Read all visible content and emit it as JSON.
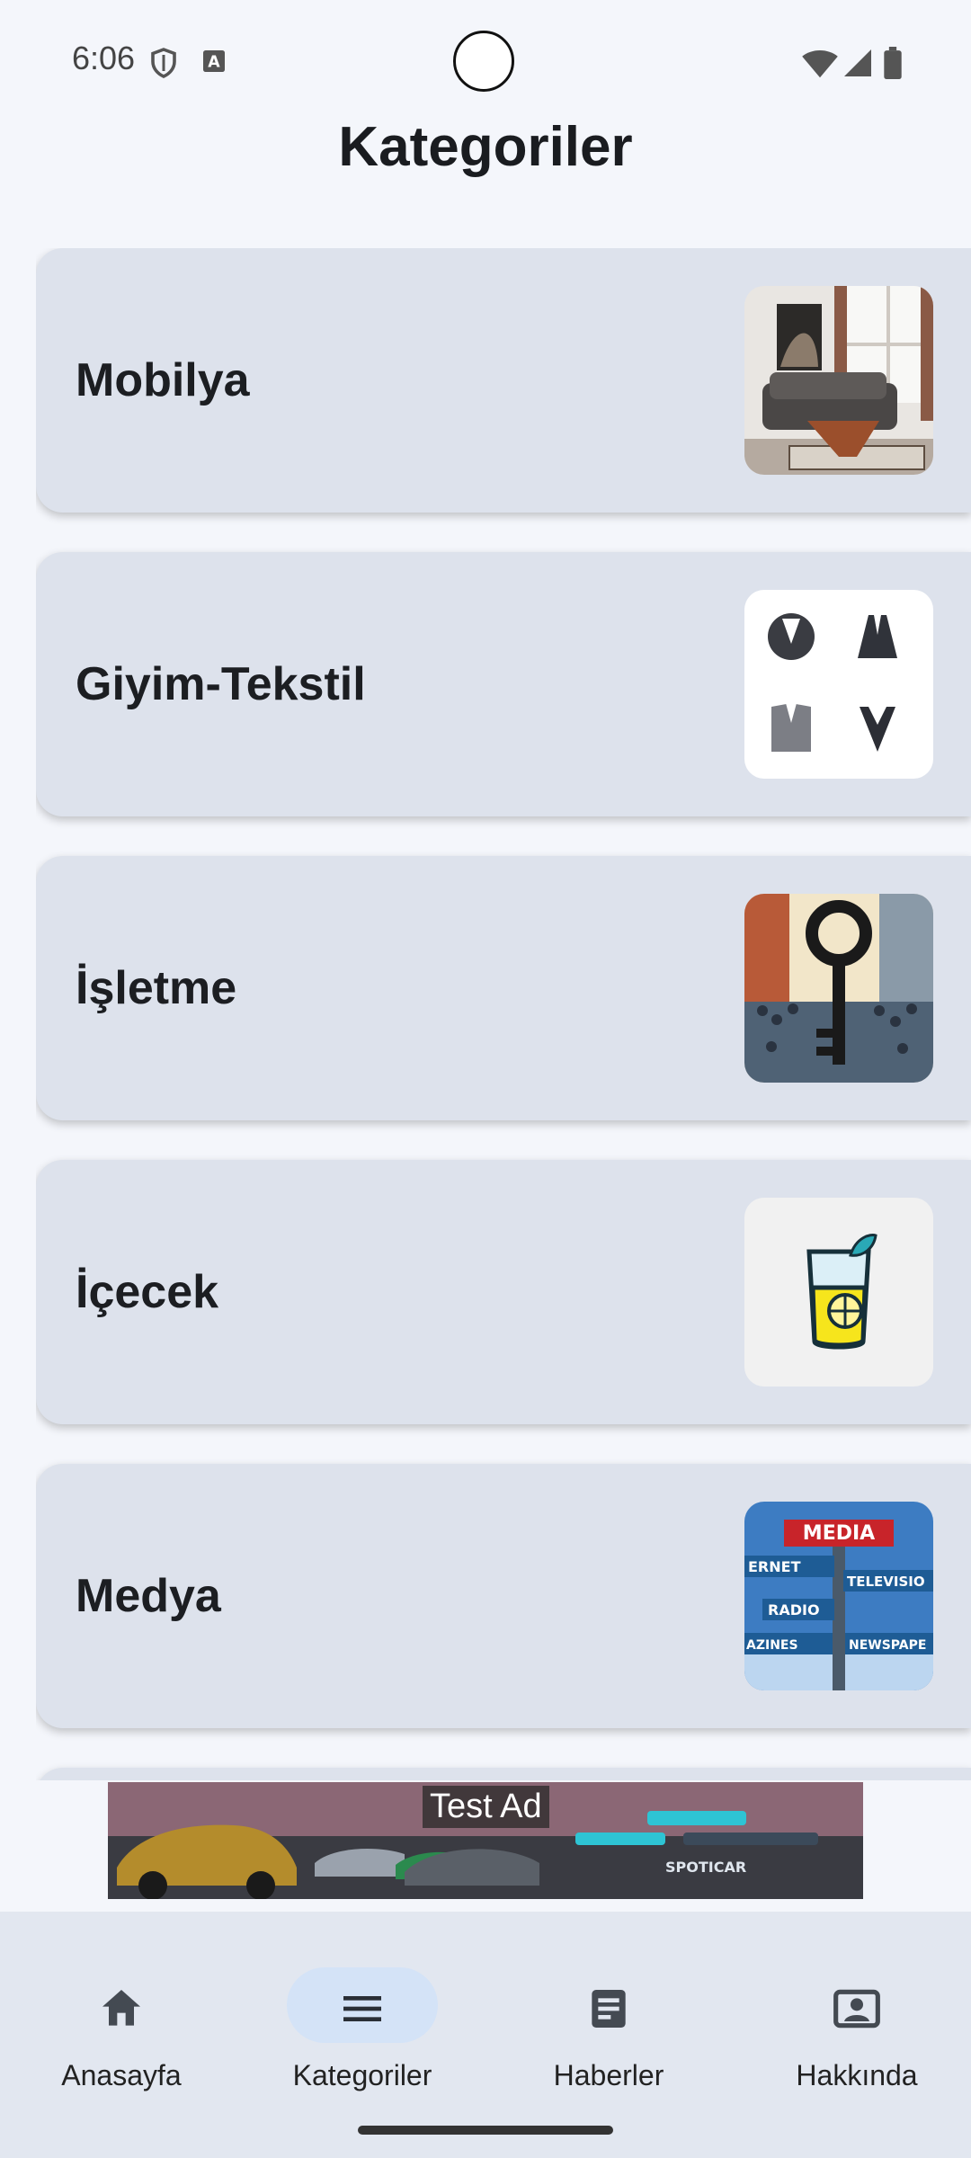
{
  "status_bar": {
    "time": "6:06"
  },
  "header": {
    "title": "Kategoriler"
  },
  "categories": [
    {
      "label": "Mobilya",
      "icon": "sofa-room-image"
    },
    {
      "label": "Giyim-Tekstil",
      "icon": "suits-image"
    },
    {
      "label": "İşletme",
      "icon": "key-crowd-image"
    },
    {
      "label": "İçecek",
      "icon": "lemonade-glass-image"
    },
    {
      "label": "Medya",
      "icon": "media-signpost-image"
    }
  ],
  "ad": {
    "label": "Test Ad"
  },
  "nav": {
    "items": [
      {
        "label": "Anasayfa",
        "icon": "home-icon"
      },
      {
        "label": "Kategoriler",
        "icon": "menu-icon",
        "active": true
      },
      {
        "label": "Haberler",
        "icon": "article-icon"
      },
      {
        "label": "Hakkında",
        "icon": "contact-card-icon"
      }
    ]
  },
  "colors": {
    "background": "#f4f6fb",
    "card": "#dde2ec",
    "nav_background": "#e2e7f0",
    "nav_active_pill": "#d4e3f7"
  }
}
